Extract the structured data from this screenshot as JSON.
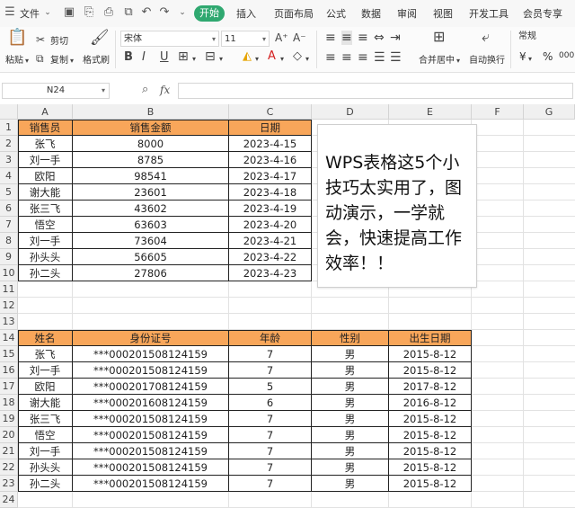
{
  "menubar": {
    "file_label": "文件",
    "tabs": [
      "开始",
      "插入",
      "页面布局",
      "公式",
      "数据",
      "审阅",
      "视图",
      "开发工具",
      "会员专享"
    ]
  },
  "ribbon": {
    "paste": "粘贴",
    "cut": "剪切",
    "copy": "复制",
    "format_painter": "格式刷",
    "font_name": "宋体",
    "font_size": "11",
    "merge_center": "合并居中",
    "wrap_text": "自动换行",
    "number_format": "常规",
    "currency_symbol": "¥",
    "percent_symbol": "%",
    "comma_symbol": "000"
  },
  "formula_bar": {
    "name_box": "N24",
    "fx_label": "fx"
  },
  "columns": [
    "A",
    "B",
    "C",
    "D",
    "E",
    "F",
    "G"
  ],
  "rows": [
    "1",
    "2",
    "3",
    "4",
    "5",
    "6",
    "7",
    "8",
    "9",
    "10",
    "11",
    "12",
    "13",
    "14",
    "15",
    "16",
    "17",
    "18",
    "19",
    "20",
    "21",
    "22",
    "23",
    "24"
  ],
  "table1": {
    "headers": [
      "销售员",
      "销售金额",
      "日期"
    ],
    "rows": [
      [
        "张飞",
        "8000",
        "2023-4-15"
      ],
      [
        "刘一手",
        "8785",
        "2023-4-16"
      ],
      [
        "欧阳",
        "98541",
        "2023-4-17"
      ],
      [
        "谢大能",
        "23601",
        "2023-4-18"
      ],
      [
        "张三飞",
        "43602",
        "2023-4-19"
      ],
      [
        "悟空",
        "63603",
        "2023-4-20"
      ],
      [
        "刘一手",
        "73604",
        "2023-4-21"
      ],
      [
        "孙头头",
        "56605",
        "2023-4-22"
      ],
      [
        "孙二头",
        "27806",
        "2023-4-23"
      ]
    ]
  },
  "textbox": {
    "text": "WPS表格这5个小技巧太实用了，图动演示，一学就会，快速提高工作效率！！"
  },
  "table2": {
    "headers": [
      "姓名",
      "身份证号",
      "年龄",
      "性别",
      "出生日期"
    ],
    "rows": [
      [
        "张飞",
        "***000201508124159",
        "7",
        "男",
        "2015-8-12"
      ],
      [
        "刘一手",
        "***000201508124159",
        "7",
        "男",
        "2015-8-12"
      ],
      [
        "欧阳",
        "***000201708124159",
        "5",
        "男",
        "2017-8-12"
      ],
      [
        "谢大能",
        "***000201608124159",
        "6",
        "男",
        "2016-8-12"
      ],
      [
        "张三飞",
        "***000201508124159",
        "7",
        "男",
        "2015-8-12"
      ],
      [
        "悟空",
        "***000201508124159",
        "7",
        "男",
        "2015-8-12"
      ],
      [
        "刘一手",
        "***000201508124159",
        "7",
        "男",
        "2015-8-12"
      ],
      [
        "孙头头",
        "***000201508124159",
        "7",
        "男",
        "2015-8-12"
      ],
      [
        "孙二头",
        "***000201508124159",
        "7",
        "男",
        "2015-8-12"
      ]
    ]
  },
  "colors": {
    "header_fill": "#f8a65a",
    "accent_green": "#2fa870"
  }
}
